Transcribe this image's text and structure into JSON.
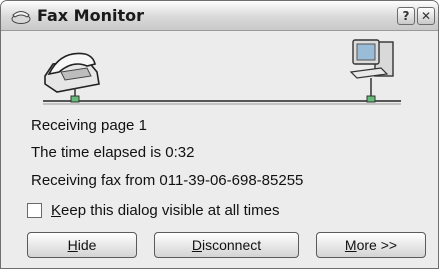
{
  "window": {
    "title": "Fax Monitor",
    "help_label": "?",
    "close_label": "✕"
  },
  "status": {
    "page_line": "Receiving page 1",
    "elapsed_line": "The time elapsed is 0:32",
    "from_line": "Receiving fax from 011-39-06-698-85255"
  },
  "options": {
    "keep_visible_accel": "K",
    "keep_visible_rest": "eep this dialog visible at all times",
    "keep_visible_checked": false
  },
  "buttons": {
    "hide_accel": "H",
    "hide_rest": "ide",
    "disconnect_accel": "D",
    "disconnect_rest": "isconnect",
    "more_accel": "M",
    "more_rest": "ore >>"
  }
}
